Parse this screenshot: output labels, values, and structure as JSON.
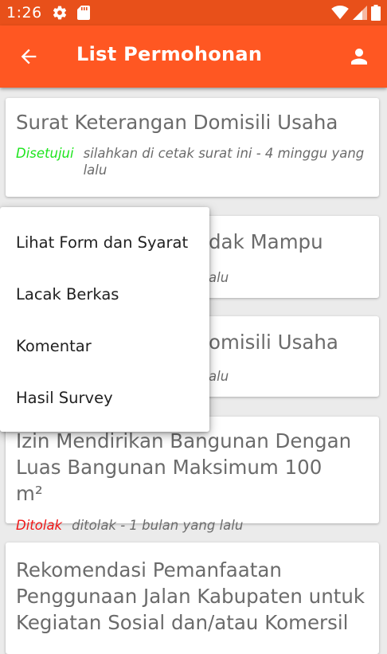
{
  "status_bar": {
    "time": "1:26",
    "icons": [
      "gear-icon",
      "sd-card-icon",
      "wifi-icon",
      "signal-icon",
      "battery-icon"
    ]
  },
  "app_bar": {
    "title": "List Permohonan",
    "back_icon": "arrow-left-icon",
    "profile_icon": "person-icon"
  },
  "colors": {
    "status_bar": "#e8501a",
    "app_bar": "#ff5722",
    "approved": "#1ee51e",
    "rejected": "#f01717"
  },
  "cards": [
    {
      "title": "Surat Keterangan Domisili Usaha",
      "status": "Disetujui",
      "description": "silahkan di cetak surat ini - 4 minggu yang lalu"
    },
    {
      "title_visible_fragment": "dak Mampu",
      "description_visible_fragment": "alu"
    },
    {
      "title_visible_fragment": "omisili Usaha",
      "description_visible_fragment": "alu"
    },
    {
      "title": "Izin Mendirikan Bangunan Dengan Luas Bangunan Maksimum 100 m²",
      "status": "Ditolak",
      "description": "ditolak - 1 bulan yang lalu"
    },
    {
      "title": "Rekomendasi Pemanfaatan Penggunaan Jalan Kabupaten untuk Kegiatan Sosial dan/atau Komersil"
    }
  ],
  "popup_menu": {
    "items": [
      "Lihat Form dan Syarat",
      "Lacak Berkas",
      "Komentar",
      "Hasil Survey"
    ]
  }
}
